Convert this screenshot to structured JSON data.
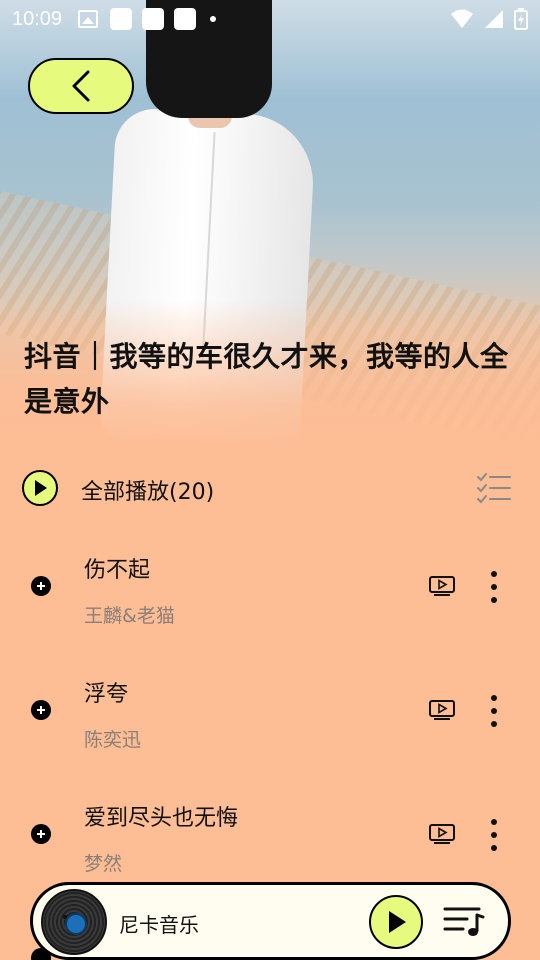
{
  "status_bar": {
    "time": "10:09",
    "icons": [
      "image-icon",
      "notification-icon",
      "notification-icon",
      "notification-icon",
      "dot-icon",
      "wifi-icon",
      "signal-icon",
      "battery-charging-icon"
    ]
  },
  "header": {
    "back_icon": "chevron-left-icon",
    "playlist_title": "抖音｜我等的车很久才来，我等的人全是意外"
  },
  "play_all": {
    "label": "全部播放(20)",
    "icon": "play-icon",
    "multi_select_icon": "checklist-icon"
  },
  "songs": [
    {
      "title": "伤不起",
      "artist": "王麟&老猫"
    },
    {
      "title": "浮夸",
      "artist": "陈奕迅"
    },
    {
      "title": "爱到尽头也无悔",
      "artist": "梦然"
    }
  ],
  "row_icons": {
    "add": "add-circle-icon",
    "mv": "mv-play-icon",
    "more": "more-vertical-icon"
  },
  "mini_player": {
    "title": "尼卡音乐",
    "disc_icon": "vinyl-disc-icon",
    "play_icon": "play-icon",
    "queue_icon": "playlist-queue-icon"
  },
  "colors": {
    "background": "#FDBD95",
    "accent": "#E6FB7E",
    "artist_text": "#8b7f78",
    "mini_player_bg": "#fffdef"
  }
}
